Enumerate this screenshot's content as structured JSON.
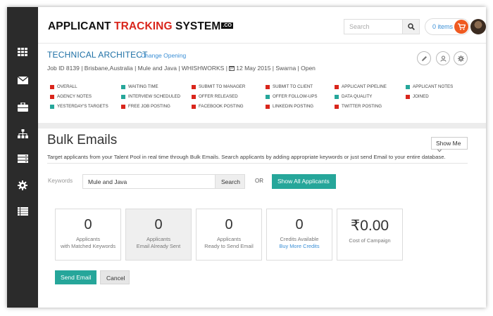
{
  "header": {
    "logo_part1": "APPLICANT ",
    "logo_part2": "TRACKING",
    "logo_part3": " SYSTEM",
    "logo_suffix": ".CO",
    "search_placeholder": "Search",
    "items_label": "0 items"
  },
  "sidebar": {
    "items": [
      {
        "icon": "grid-icon"
      },
      {
        "icon": "envelope-icon"
      },
      {
        "icon": "briefcase-icon"
      },
      {
        "icon": "sitemap-icon"
      },
      {
        "icon": "server-icon"
      },
      {
        "icon": "gear-icon"
      },
      {
        "icon": "list-icon"
      }
    ]
  },
  "job": {
    "title": "TECHNICAL ARCHITECT",
    "change_link": "Change Opening",
    "meta_pre": "Job ID 8139 | Brisbane,Australia | Mule and Java | WHISHWORKS | ",
    "meta_date": "12 May 2015",
    "meta_post": " | Swarna | Open"
  },
  "statuses": [
    {
      "label": "OVERALL",
      "color": "#d9261c"
    },
    {
      "label": "WAITING TIME",
      "color": "#26a69a"
    },
    {
      "label": "SUBMIT TO MANAGER",
      "color": "#d9261c"
    },
    {
      "label": "SUBMIT TO CLIENT",
      "color": "#d9261c"
    },
    {
      "label": "APPLICANT PIPELINE",
      "color": "#d9261c"
    },
    {
      "label": "APPLICANT NOTES",
      "color": "#26a69a"
    },
    {
      "label": "AGENCY NOTES",
      "color": "#d9261c"
    },
    {
      "label": "INTERVIEW SCHEDULED",
      "color": "#26a69a"
    },
    {
      "label": "OFFER RELEASED",
      "color": "#d9261c"
    },
    {
      "label": "OFFER FOLLOW-UPS",
      "color": "#26a69a"
    },
    {
      "label": "DATA QUALITY",
      "color": "#26a69a"
    },
    {
      "label": "JOINED",
      "color": "#d9261c"
    },
    {
      "label": "YESTERDAY'S TARGETS",
      "color": "#26a69a"
    },
    {
      "label": "FREE JOB POSTING",
      "color": "#d9261c"
    },
    {
      "label": "FACEBOOK POSTING",
      "color": "#d9261c"
    },
    {
      "label": "LINKEDIN POSTING",
      "color": "#d9261c"
    },
    {
      "label": "TWITTER POSTING",
      "color": "#d9261c"
    }
  ],
  "bulk": {
    "title": "Bulk Emails",
    "show_me": "Show Me",
    "description": "Target applicants from your Talent Pool in real time through Bulk Emails. Search applicants by adding appropriate keywords or just send Email to your entire database.",
    "keywords_label": "Keywords",
    "keywords_value": "Mule and Java",
    "search_button": "Search",
    "or_text": "OR",
    "show_all_button": "Show All Applicants",
    "cards": [
      {
        "value": "0",
        "line1": "Applicants",
        "line2": "with Matched Keywords"
      },
      {
        "value": "0",
        "line1": "Applicants",
        "line2": "Email Already Sent"
      },
      {
        "value": "0",
        "line1": "Applicants",
        "line2": "Ready to Send Email"
      },
      {
        "value": "0",
        "line1": "Credits Available",
        "line2": "Buy More Credits"
      },
      {
        "value": "₹0.00",
        "line1": "Cost of Campaign",
        "line2": ""
      }
    ],
    "send_button": "Send Email",
    "cancel_button": "Cancel"
  },
  "colors": {
    "accent": "#26a69a",
    "brand_red": "#d9261c",
    "link": "#3a8fd6",
    "sidebar": "#2b2b2b"
  }
}
